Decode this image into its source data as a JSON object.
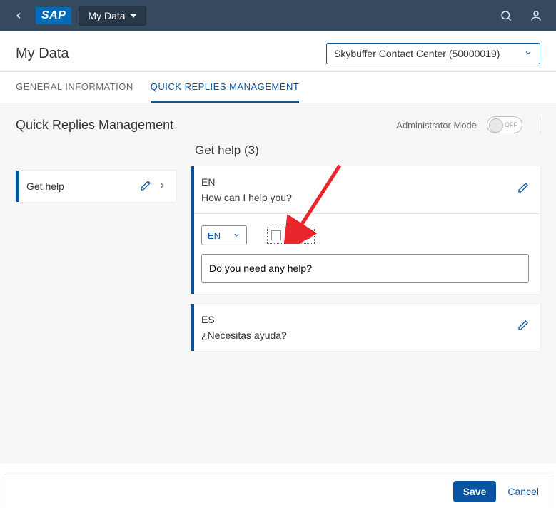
{
  "shell": {
    "logo_text": "SAP",
    "title": "My Data"
  },
  "page": {
    "title": "My Data",
    "company_select": "Skybuffer Contact Center (50000019)"
  },
  "tabs": {
    "general": "GENERAL INFORMATION",
    "quick_replies": "QUICK REPLIES MANAGEMENT"
  },
  "section": {
    "title": "Quick Replies Management",
    "admin_mode_label": "Administrator Mode",
    "toggle_off": "OFF"
  },
  "topic": {
    "label": "Get help"
  },
  "detail": {
    "title": "Get help (3)"
  },
  "replies": [
    {
      "lang": "EN",
      "text": "How can I help you?"
    },
    {
      "lang": "ES",
      "text": "¿Necesitas ayuda?"
    }
  ],
  "edit": {
    "lang_selected": "EN",
    "active_label": "Active",
    "input_value": "Do you need any help?"
  },
  "footer": {
    "save": "Save",
    "cancel": "Cancel"
  }
}
